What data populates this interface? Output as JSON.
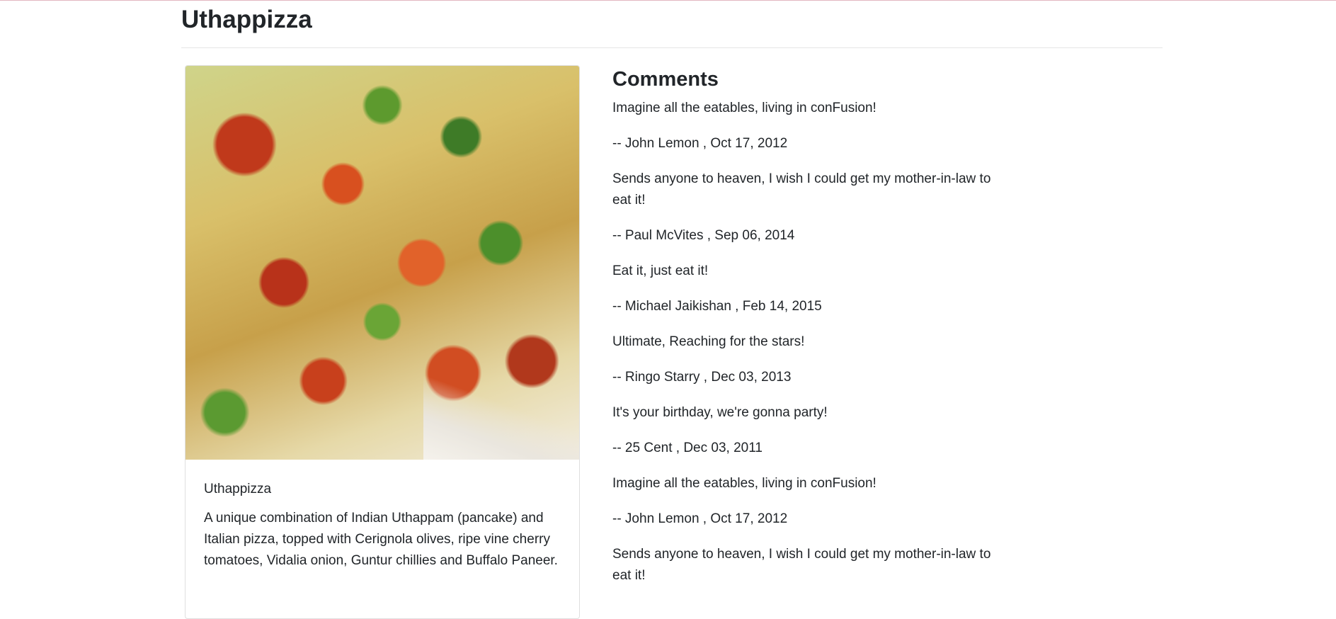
{
  "dish": {
    "name": "Uthappizza",
    "card_title": "Uthappizza",
    "description": "A unique combination of Indian Uthappam (pancake) and Italian pizza, topped with Cerignola olives, ripe vine cherry tomatoes, Vidalia onion, Guntur chillies and Buffalo Paneer."
  },
  "comments": {
    "heading": "Comments",
    "items": [
      {
        "text": "Imagine all the eatables, living in conFusion!",
        "author_line": "-- John Lemon , Oct 17, 2012"
      },
      {
        "text": "Sends anyone to heaven, I wish I could get my mother-in-law to eat it!",
        "author_line": "-- Paul McVites , Sep 06, 2014"
      },
      {
        "text": "Eat it, just eat it!",
        "author_line": "-- Michael Jaikishan , Feb 14, 2015"
      },
      {
        "text": "Ultimate, Reaching for the stars!",
        "author_line": "-- Ringo Starry , Dec 03, 2013"
      },
      {
        "text": "It's your birthday, we're gonna party!",
        "author_line": "-- 25 Cent , Dec 03, 2011"
      },
      {
        "text": "Imagine all the eatables, living in conFusion!",
        "author_line": "-- John Lemon , Oct 17, 2012"
      },
      {
        "text": "Sends anyone to heaven, I wish I could get my mother-in-law to eat it!",
        "author_line": ""
      }
    ]
  }
}
